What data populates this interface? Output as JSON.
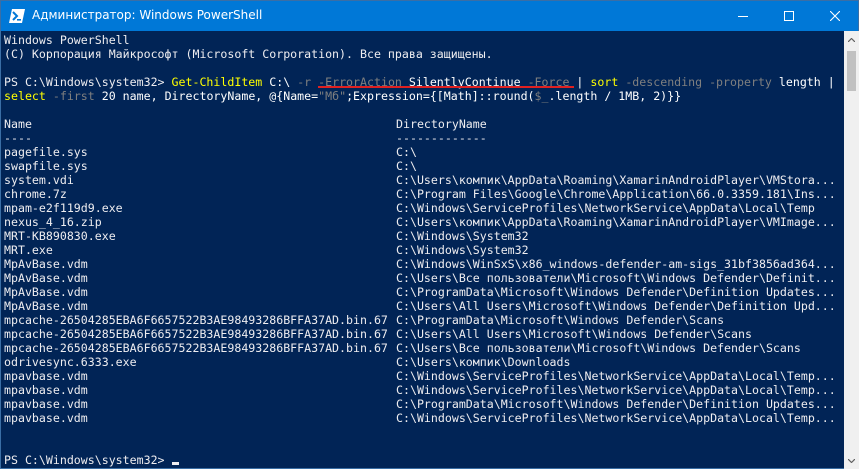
{
  "window": {
    "title": "Администратор: Windows PowerShell",
    "colors": {
      "titlebar": "#0078d7",
      "console_bg": "#012456",
      "text": "#eeedf0",
      "cmdlet": "#ffff00",
      "parameter": "#7f7f7f",
      "annotation": "#e02020"
    }
  },
  "header": {
    "line1": "Windows PowerShell",
    "line2": "(C) Корпорация Майкрософт (Microsoft Corporation). Все права защищены."
  },
  "command": {
    "prompt": "PS C:\\Windows\\system32> ",
    "cmdlet1": "Get-ChildItem",
    "path": " C:\\ ",
    "param_r": "-r",
    "param_erroraction": "-ErrorAction",
    "value_silently": "SilentlyContinue",
    "param_force": "-Force",
    "pipe1": " | ",
    "cmdlet2": "sort",
    "param_descending": "-descending",
    "param_property": "-property",
    "value_length": " length |",
    "cmdlet3": "select",
    "param_first": "-first",
    "select_args1": " 20 name, DirectoryName, @{Name=",
    "select_name_value": "\"Мб\"",
    "select_args2": ";Expression={[Math]::round(",
    "select_var": "$_",
    "select_args3": ".length / 1MB, 2)}}"
  },
  "table": {
    "headers": [
      "Name",
      "DirectoryName"
    ],
    "underline": [
      "----",
      "-------------"
    ],
    "rows": [
      [
        "pagefile.sys",
        "C:\\"
      ],
      [
        "swapfile.sys",
        "C:\\"
      ],
      [
        "system.vdi",
        "C:\\Users\\компик\\AppData\\Roaming\\XamarinAndroidPlayer\\VMStora..."
      ],
      [
        "chrome.7z",
        "C:\\Program Files\\Google\\Chrome\\Application\\66.0.3359.181\\Ins..."
      ],
      [
        "mpam-e2f119d9.exe",
        "C:\\Windows\\ServiceProfiles\\NetworkService\\AppData\\Local\\Temp"
      ],
      [
        "nexus_4_16.zip",
        "C:\\Users\\компик\\AppData\\Roaming\\XamarinAndroidPlayer\\VMImage..."
      ],
      [
        "MRT-KB890830.exe",
        "C:\\Windows\\System32"
      ],
      [
        "MRT.exe",
        "C:\\Windows\\System32"
      ],
      [
        "MpAvBase.vdm",
        "C:\\Windows\\WinSxS\\x86_windows-defender-am-sigs_31bf3856ad364..."
      ],
      [
        "MpAvBase.vdm",
        "C:\\Users\\Все пользователи\\Microsoft\\Windows Defender\\Definit..."
      ],
      [
        "MpAvBase.vdm",
        "C:\\ProgramData\\Microsoft\\Windows Defender\\Definition Updates..."
      ],
      [
        "MpAvBase.vdm",
        "C:\\Users\\All Users\\Microsoft\\Windows Defender\\Definition Upd..."
      ],
      [
        "mpcache-26504285EBA6F6657522B3AE98493286BFFA37AD.bin.67",
        "C:\\ProgramData\\Microsoft\\Windows Defender\\Scans"
      ],
      [
        "mpcache-26504285EBA6F6657522B3AE98493286BFFA37AD.bin.67",
        "C:\\Users\\All Users\\Microsoft\\Windows Defender\\Scans"
      ],
      [
        "mpcache-26504285EBA6F6657522B3AE98493286BFFA37AD.bin.67",
        "C:\\Users\\Все пользователи\\Microsoft\\Windows Defender\\Scans"
      ],
      [
        "odrivesync.6333.exe",
        "C:\\Users\\компик\\Downloads"
      ],
      [
        "mpavbase.vdm",
        "C:\\Windows\\ServiceProfiles\\NetworkService\\AppData\\Local\\Temp..."
      ],
      [
        "mpavbase.vdm",
        "C:\\Windows\\ServiceProfiles\\NetworkService\\AppData\\Local\\Temp..."
      ],
      [
        "mpavbase.vdm",
        "C:\\ProgramData\\Microsoft\\Windows Defender\\Definition Updates..."
      ],
      [
        "mpavbase.vdm",
        "C:\\Windows\\ServiceProfiles\\NetworkService\\AppData\\Local\\Temp..."
      ]
    ]
  },
  "final_prompt": "PS C:\\Windows\\system32> "
}
